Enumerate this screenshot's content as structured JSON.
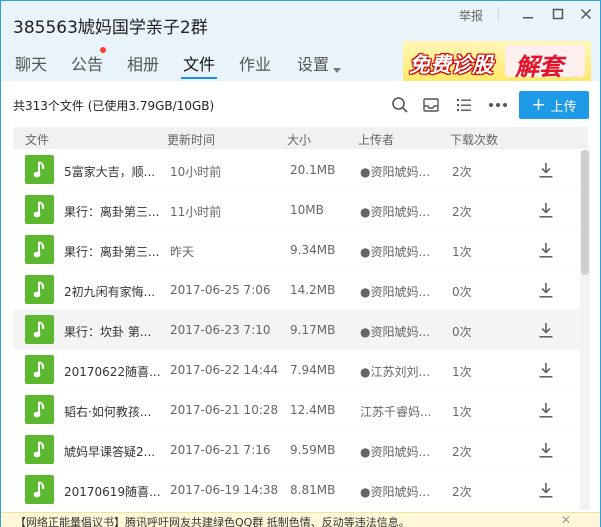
{
  "window": {
    "title": "385563虓妈国学亲子2群",
    "report_label": "举报",
    "minimize_icon": "minimize-icon",
    "maximize_icon": "maximize-icon",
    "close_icon": "close-icon"
  },
  "tabs": [
    {
      "label": "聊天"
    },
    {
      "label": "公告"
    },
    {
      "label": "相册"
    },
    {
      "label": "文件"
    },
    {
      "label": "作业"
    },
    {
      "label": "设置"
    }
  ],
  "ad": {
    "text1": "免费诊股",
    "text2": "解套"
  },
  "toolbar": {
    "summary": "共313个文件 (已使用3.79GB/10GB)",
    "upload_label": "上传",
    "upload_plus": "+"
  },
  "columns": {
    "file": "文件",
    "updated": "更新时间",
    "size": "大小",
    "uploader": "上传者",
    "downloads": "下载次数"
  },
  "files": [
    {
      "name": "5富家大吉，顺...",
      "time": "10小时前",
      "size": "20.1MB",
      "uploader": "●资阳虓妈...",
      "downloads": "2次"
    },
    {
      "name": "果行：离卦第三...",
      "time": "11小时前",
      "size": "10MB",
      "uploader": "●资阳虓妈...",
      "downloads": "2次"
    },
    {
      "name": "果行：离卦第三...",
      "time": "昨天",
      "size": "9.34MB",
      "uploader": "●资阳虓妈...",
      "downloads": "1次"
    },
    {
      "name": "2初九闲有家悔...",
      "time": "2017-06-25 7:06",
      "size": "14.2MB",
      "uploader": "●资阳虓妈...",
      "downloads": "0次"
    },
    {
      "name": "果行：坎卦 第...",
      "time": "2017-06-23 7:10",
      "size": "9.17MB",
      "uploader": "●资阳虓妈...",
      "downloads": "0次"
    },
    {
      "name": "20170622随喜...",
      "time": "2017-06-22 14:44",
      "size": "7.94MB",
      "uploader": "●江苏刘刘...",
      "downloads": "1次"
    },
    {
      "name": "韬右·如何教孩...",
      "time": "2017-06-21 10:28",
      "size": "12.4MB",
      "uploader": "江苏千睿妈...",
      "downloads": "1次"
    },
    {
      "name": "虓妈早课答疑2...",
      "time": "2017-06-21 7:16",
      "size": "9.59MB",
      "uploader": "●资阳虓妈...",
      "downloads": "2次"
    },
    {
      "name": "20170619随喜...",
      "time": "2017-06-19 14:38",
      "size": "8.81MB",
      "uploader": "●资阳虓妈...",
      "downloads": "2次"
    }
  ],
  "notice": {
    "text": "【网络正能量倡议书】腾讯呼吁网友共建绿色QQ群 抵制色情、反动等违法信息。",
    "close": "✕"
  }
}
